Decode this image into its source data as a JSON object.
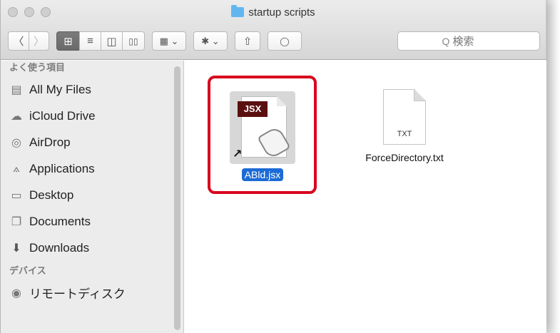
{
  "window": {
    "title": "startup scripts"
  },
  "toolbar": {
    "back_glyph": "〈",
    "forward_glyph": "〉",
    "view_icon_glyph": "⊞",
    "view_list_glyph": "≡",
    "view_column_glyph": "◫",
    "view_coverflow_glyph": "▯▯",
    "arrange_glyph": "▦ ⌄",
    "action_glyph": "✱ ⌄",
    "share_glyph": "⇧",
    "tag_glyph": "◯"
  },
  "search": {
    "placeholder": "検索",
    "icon": "search-icon",
    "icon_glyph": "Q"
  },
  "sidebar": {
    "favorites_header": "よく使う項目",
    "favorites": [
      {
        "label": "All My Files",
        "icon": "all-files-icon",
        "glyph": "▤"
      },
      {
        "label": "iCloud Drive",
        "icon": "cloud-icon",
        "glyph": "☁"
      },
      {
        "label": "AirDrop",
        "icon": "airdrop-icon",
        "glyph": "◎"
      },
      {
        "label": "Applications",
        "icon": "applications-icon",
        "glyph": "⟑"
      },
      {
        "label": "Desktop",
        "icon": "desktop-icon",
        "glyph": "▭"
      },
      {
        "label": "Documents",
        "icon": "documents-icon",
        "glyph": "❐"
      },
      {
        "label": "Downloads",
        "icon": "downloads-icon",
        "glyph": "⬇"
      }
    ],
    "devices_header": "デバイス",
    "devices": [
      {
        "label": "リモートディスク",
        "icon": "remote-disc-icon",
        "glyph": "◉"
      }
    ]
  },
  "files": [
    {
      "name": "ABld.jsx",
      "badge": "JSX",
      "selected": true,
      "alias_glyph": "↗"
    },
    {
      "name": "ForceDirectory.txt",
      "badge": "TXT",
      "selected": false
    }
  ],
  "colors": {
    "selection": "#1b6bd6",
    "highlight_box": "#d8071e",
    "folder": "#62b6f0"
  }
}
